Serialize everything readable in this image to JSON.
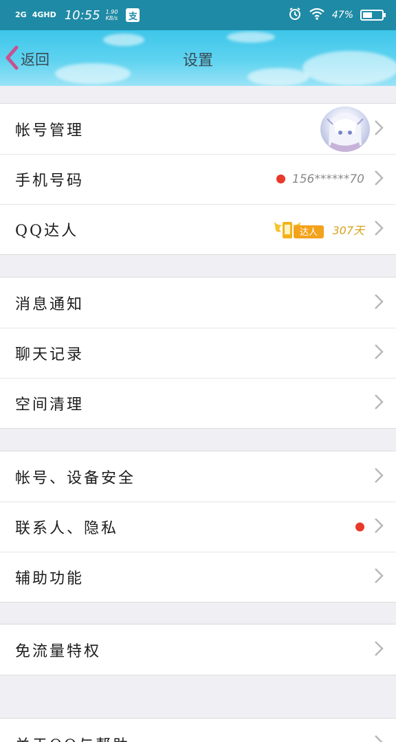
{
  "status_bar": {
    "signal_1": "2G",
    "signal_2": "4GHD",
    "time": "10:55",
    "speed_value": "1.90",
    "speed_unit": "KB/s",
    "app_badge": "支",
    "battery": "47%"
  },
  "header": {
    "back_label": "返回",
    "title": "设置"
  },
  "groups": [
    {
      "rows": [
        {
          "label": "帐号管理",
          "extra": "avatar"
        },
        {
          "label": "手机号码",
          "value": "156******70",
          "red_dot": true
        },
        {
          "label": "QQ达人",
          "badge": "达人",
          "days": "307天"
        }
      ]
    },
    {
      "rows": [
        {
          "label": "消息通知"
        },
        {
          "label": "聊天记录"
        },
        {
          "label": "空间清理"
        }
      ]
    },
    {
      "rows": [
        {
          "label": "帐号、设备安全"
        },
        {
          "label": "联系人、隐私",
          "red_dot": true
        },
        {
          "label": "辅助功能"
        }
      ]
    },
    {
      "rows": [
        {
          "label": "免流量特权"
        }
      ]
    },
    {
      "rows": [
        {
          "label": "关于QQ与帮助"
        }
      ]
    }
  ],
  "colors": {
    "status_bar": "#1f8aa5",
    "header_sky": "#3ec6ea",
    "red_dot": "#e8392b",
    "daren_gold": "#d7a21e",
    "back_chevron": "#c9508f"
  },
  "icons": [
    "wifi-icon",
    "alarm-icon",
    "battery-icon",
    "back-chevron-icon",
    "chevron-right-icon",
    "daren-badge-icon"
  ]
}
